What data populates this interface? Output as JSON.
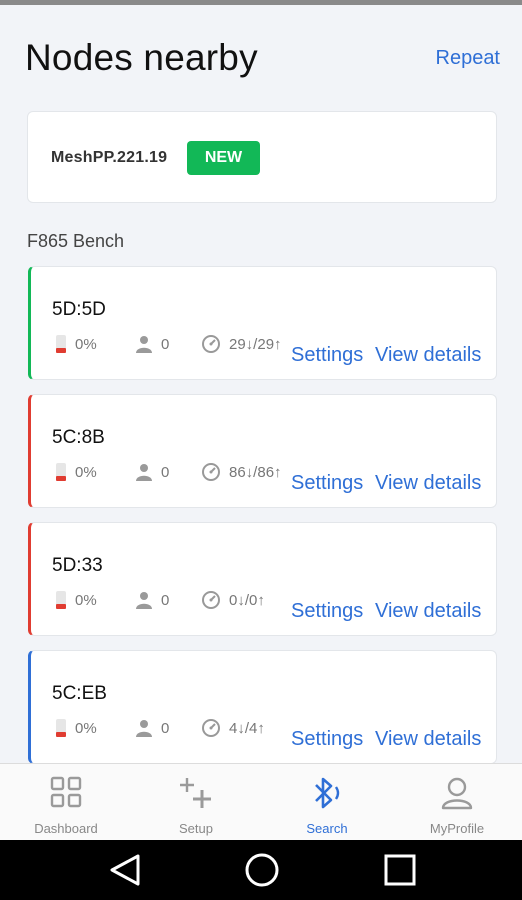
{
  "header": {
    "title": "Nodes nearby",
    "repeat_label": "Repeat"
  },
  "firmware": {
    "version": "MeshPP.221.19",
    "badge": "NEW"
  },
  "group": {
    "label": "F865 Bench"
  },
  "colors": {
    "accent": "#2f6fd6",
    "green": "#12b857",
    "red": "#e03c31",
    "blue": "#2f6fd6"
  },
  "nodes": [
    {
      "id": "5D:5D",
      "battery": "0%",
      "users": "0",
      "traffic": "29↓/29↑",
      "status_color": "#12b857",
      "settings_label": "Settings",
      "details_label": "View details"
    },
    {
      "id": "5C:8B",
      "battery": "0%",
      "users": "0",
      "traffic": "86↓/86↑",
      "status_color": "#e03c31",
      "settings_label": "Settings",
      "details_label": "View details"
    },
    {
      "id": "5D:33",
      "battery": "0%",
      "users": "0",
      "traffic": "0↓/0↑",
      "status_color": "#e03c31",
      "settings_label": "Settings",
      "details_label": "View details"
    },
    {
      "id": "5C:EB",
      "battery": "0%",
      "users": "0",
      "traffic": "4↓/4↑",
      "status_color": "#2f6fd6",
      "settings_label": "Settings",
      "details_label": "View details"
    }
  ],
  "bottom_nav": {
    "items": [
      {
        "label": "Dashboard",
        "icon": "grid-icon",
        "active": false
      },
      {
        "label": "Setup",
        "icon": "plus-setup-icon",
        "active": false
      },
      {
        "label": "Search",
        "icon": "bluetooth-search-icon",
        "active": true
      },
      {
        "label": "MyProfile",
        "icon": "person-icon",
        "active": false
      }
    ]
  },
  "system_nav": {
    "back_icon": "back-triangle-icon",
    "home_icon": "home-circle-icon",
    "recents_icon": "recents-square-icon"
  }
}
